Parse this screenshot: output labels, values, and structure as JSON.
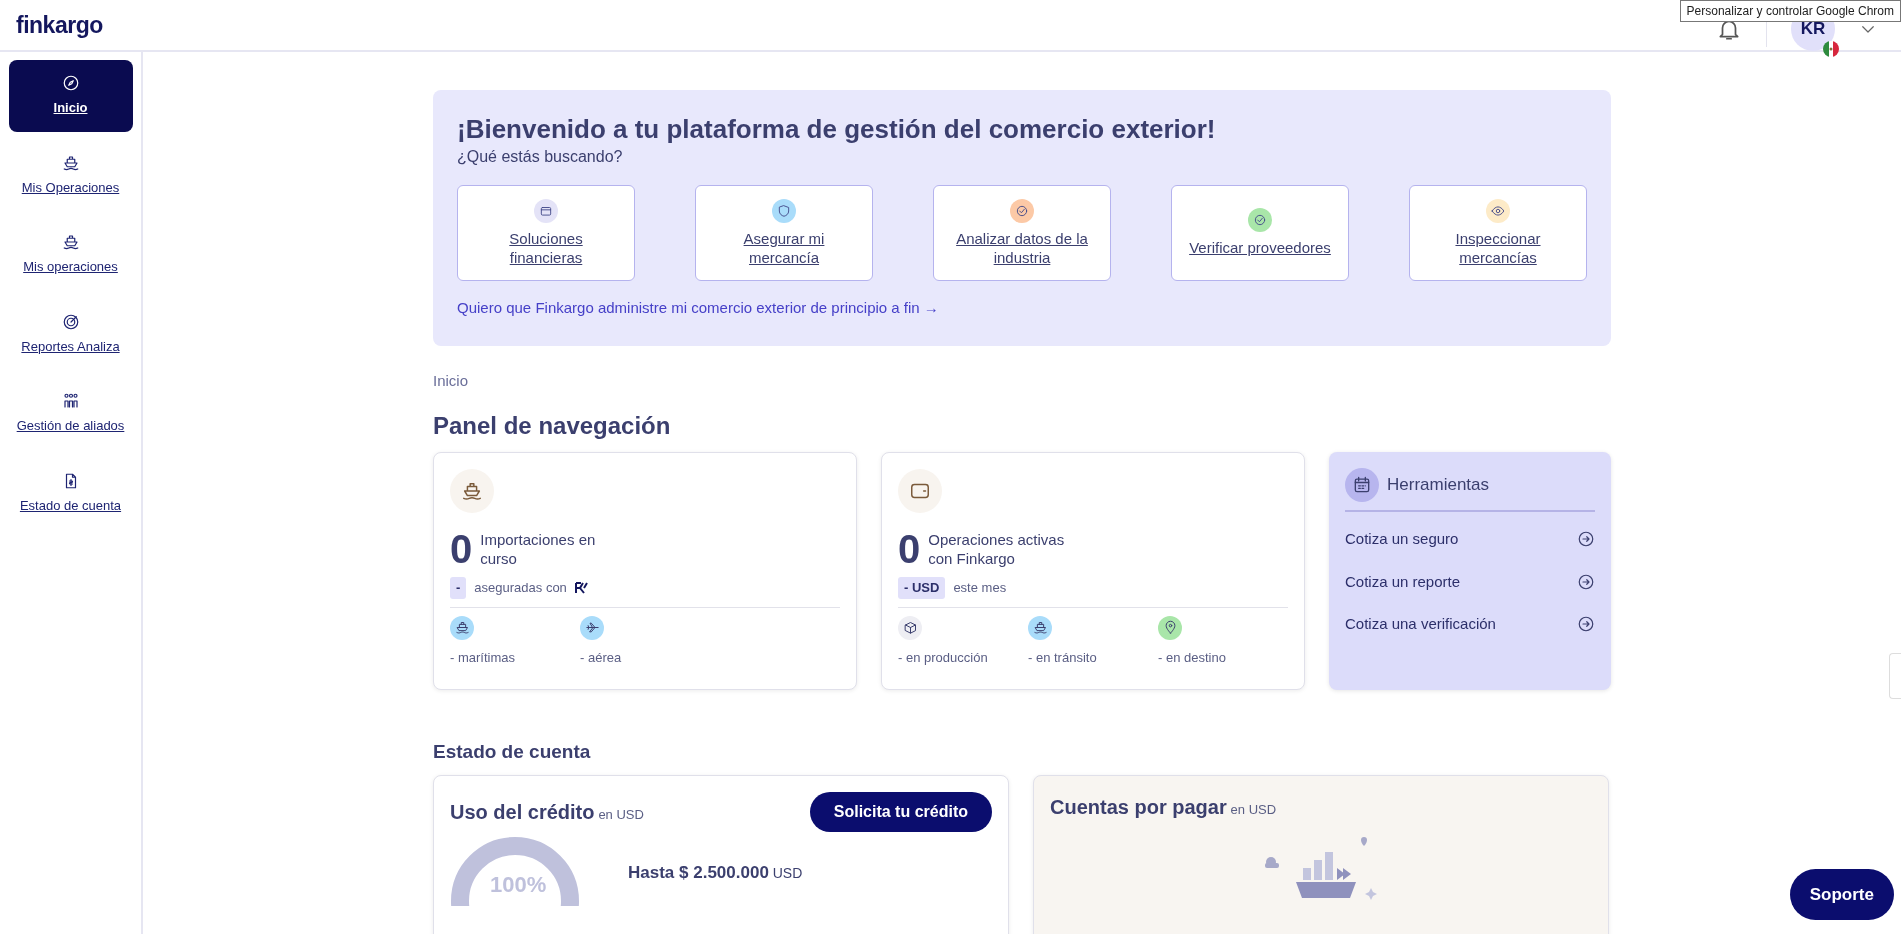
{
  "header": {
    "logo": "finkargo",
    "avatar_initials": "KR",
    "tooltip": "Personalizar y controlar Google Chrom"
  },
  "sidebar": {
    "items": [
      {
        "label": "Inicio",
        "selected": true,
        "kind": "compass"
      },
      {
        "label": "Mis Operaciones",
        "selected": false,
        "kind": "ship"
      },
      {
        "label": "Mis operaciones",
        "selected": false,
        "kind": "ship"
      },
      {
        "label": "Reportes Analiza",
        "selected": false,
        "kind": "radar"
      },
      {
        "label": "Gestión de aliados",
        "selected": false,
        "kind": "people"
      },
      {
        "label": "Estado de cuenta",
        "selected": false,
        "kind": "document"
      }
    ]
  },
  "welcome": {
    "title": "¡Bienvenido a tu plataforma de gestión del comercio exterior!",
    "subtitle": "¿Qué estás buscando?",
    "options": [
      {
        "label": "Soluciones financieras",
        "kind": "folder",
        "color": "#e4e3f7"
      },
      {
        "label": "Asegurar mi mercancía",
        "kind": "shield",
        "color": "#a9dcfa"
      },
      {
        "label": "Analizar datos de la industria",
        "kind": "check",
        "color": "#fcc9a6"
      },
      {
        "label": "Verificar proveedores",
        "kind": "check",
        "color": "#a9e6a9"
      },
      {
        "label": "Inspeccionar mercancías",
        "kind": "eye",
        "color": "#fdebc8"
      }
    ],
    "link": "Quiero que Finkargo administre mi comercio exterior de principio a fin",
    "link_arrow": "→"
  },
  "breadcrumb": "Inicio",
  "panel": {
    "title": "Panel de navegación",
    "cards": [
      {
        "kind": "ship",
        "count": "0",
        "label": "Importaciones en curso",
        "badge": "-",
        "note": "aseguradas con",
        "stats": [
          {
            "kind": "ship",
            "color": "#a9dcfa",
            "label": "- marítimas"
          },
          {
            "kind": "plane",
            "color": "#a9dcfa",
            "label": "- aérea"
          }
        ]
      },
      {
        "kind": "wallet",
        "count": "0",
        "label": "Operaciones activas con Finkargo",
        "badge": "- USD",
        "note": "este mes",
        "stats": [
          {
            "kind": "box",
            "color": "#eeeef3",
            "label": "- en producción"
          },
          {
            "kind": "ship",
            "color": "#a9dcfa",
            "label": "- en tránsito"
          },
          {
            "kind": "pin",
            "color": "#a9e6a9",
            "label": "- en destino"
          }
        ]
      }
    ],
    "tools": {
      "title": "Herramientas",
      "links": [
        "Cotiza un seguro",
        "Cotiza un reporte",
        "Cotiza una verificación"
      ]
    }
  },
  "account": {
    "title": "Estado de cuenta",
    "credit": {
      "title": "Uso del crédito",
      "unit": "en USD",
      "button": "Solicita tu crédito",
      "percent": "100%",
      "limit_amount": "Hasta $ 2.500.000",
      "limit_unit": "USD"
    },
    "payables": {
      "title": "Cuentas por pagar",
      "unit": "en USD"
    }
  },
  "support_button": "Soporte"
}
